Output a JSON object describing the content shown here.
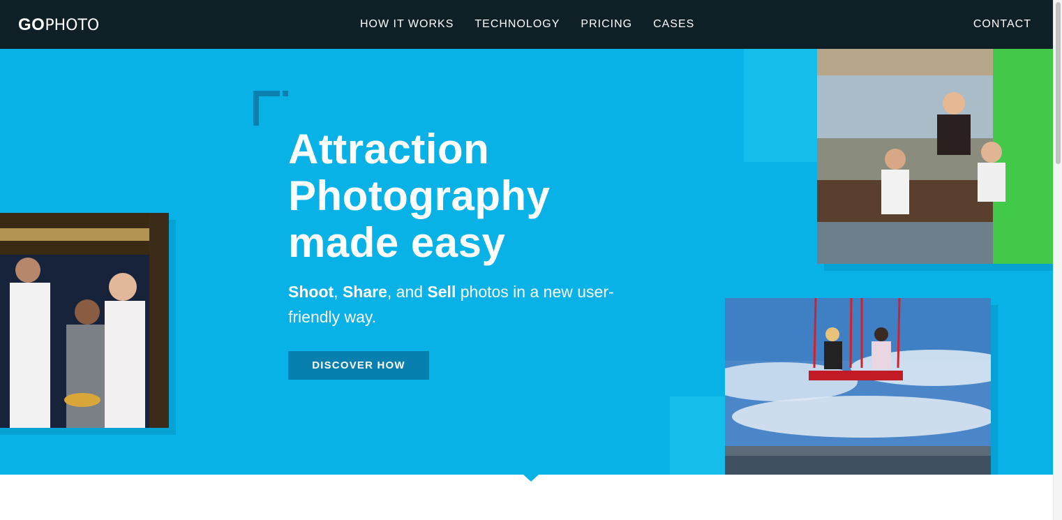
{
  "header": {
    "logo_bold": "GO",
    "logo_thin": "PHOTO",
    "nav": [
      {
        "label": "HOW IT WORKS"
      },
      {
        "label": "TECHNOLOGY"
      },
      {
        "label": "PRICING"
      },
      {
        "label": "CASES"
      }
    ],
    "contact_label": "CONTACT"
  },
  "hero": {
    "headline": [
      "Attraction",
      "Photography",
      "made easy"
    ],
    "sub": {
      "shoot": "Shoot",
      "sep1": ", ",
      "share": "Share",
      "sep2": ", and ",
      "sell": "Sell",
      "rest": " photos in a new user-friendly way."
    },
    "cta_label": "DISCOVER HOW"
  },
  "colors": {
    "header_bg": "#0e1f26",
    "hero_bg": "#08b1e6",
    "cta_bg": "#0780af",
    "accent_green": "#42c94a"
  },
  "icons": {
    "corner": "bracket-corner-icon",
    "pointer": "down-pointer-icon"
  }
}
